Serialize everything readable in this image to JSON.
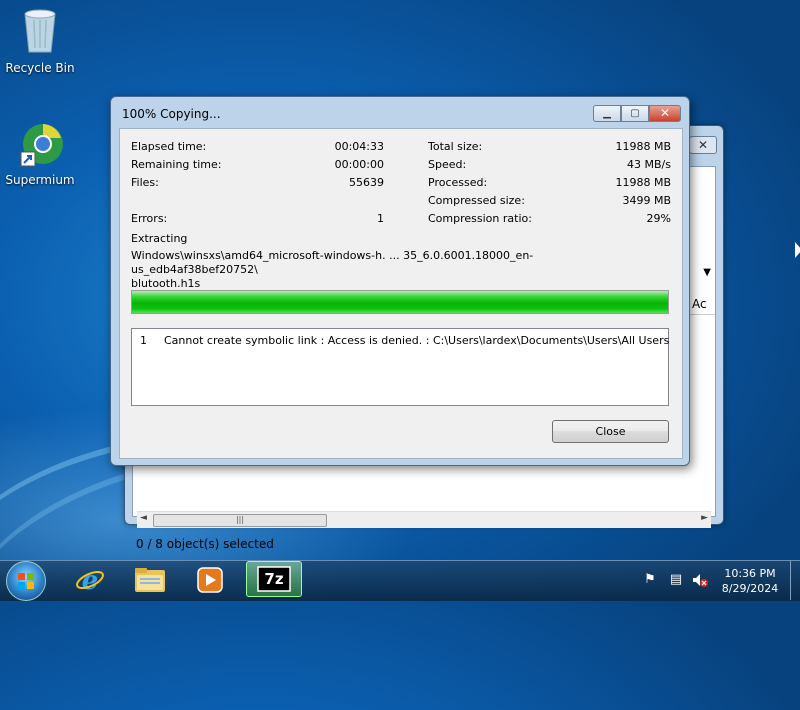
{
  "desktop": {
    "icons": [
      {
        "label": "Recycle Bin",
        "icon": "recycle-bin-icon"
      },
      {
        "label": "Supermium",
        "icon": "supermium-browser-icon"
      }
    ]
  },
  "background_window": {
    "status_bar": "0 / 8 object(s) selected",
    "column_header_partial": "Ac",
    "close_glyph": "✕"
  },
  "dialog": {
    "title": "100% Copying...",
    "left_stats": [
      {
        "label": "Elapsed time:",
        "value": "00:04:33"
      },
      {
        "label": "Remaining time:",
        "value": "00:00:00"
      },
      {
        "label": "Files:",
        "value": "55639"
      }
    ],
    "right_stats": [
      {
        "label": "Total size:",
        "value": "11988 MB"
      },
      {
        "label": "Speed:",
        "value": "43 MB/s"
      },
      {
        "label": "Processed:",
        "value": "11988 MB"
      },
      {
        "label": "Compressed size:",
        "value": "3499 MB"
      },
      {
        "label": "Compression ratio:",
        "value": "29%"
      }
    ],
    "errors": {
      "label": "Errors:",
      "value": "1"
    },
    "operation": "Extracting",
    "current_file_line1": "Windows\\winsxs\\amd64_microsoft-windows-h. ... 35_6.0.6001.18000_en-us_edb4af38bef20752\\",
    "current_file_line2": "blutooth.h1s",
    "progress_fraction": 1.0,
    "error_list": [
      {
        "num": "1",
        "message": "Cannot create symbolic link : Access is denied. : C:\\Users\\lardex\\Documents\\Users\\All Users"
      }
    ],
    "close_button": "Close"
  },
  "taskbar": {
    "items": [
      {
        "name": "start-button",
        "icon": "windows-logo-icon"
      },
      {
        "name": "internet-explorer",
        "icon": "internet-explorer-icon"
      },
      {
        "name": "file-explorer",
        "icon": "folder-icon"
      },
      {
        "name": "media-player",
        "icon": "media-player-icon"
      },
      {
        "name": "7zip",
        "icon": "7zip-icon",
        "label": "7z",
        "active": true
      }
    ],
    "clock_time": "10:36 PM",
    "clock_date": "8/29/2024"
  },
  "colors": {
    "progress_green": "#06b406",
    "desktop_blue": "#0b5fb0",
    "dialog_frame": "#bdd3ea"
  }
}
